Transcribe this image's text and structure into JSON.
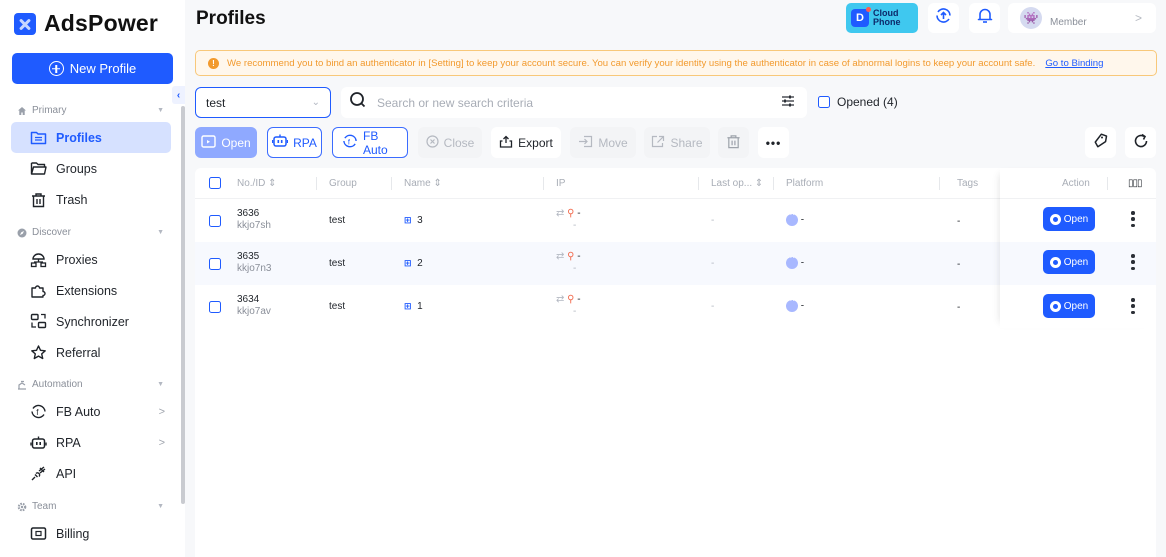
{
  "app": {
    "brand": "AdsPower",
    "page_title": "Profiles"
  },
  "sidebar": {
    "new_profile_label": "New Profile",
    "sections": [
      {
        "label": "Primary",
        "icon": "home-icon"
      },
      {
        "label": "Discover",
        "icon": "compass-icon"
      },
      {
        "label": "Automation",
        "icon": "automation-icon"
      },
      {
        "label": "Team",
        "icon": "gear-icon"
      }
    ],
    "items": [
      {
        "label": "Profiles",
        "icon": "folder-list-icon",
        "active": true
      },
      {
        "label": "Groups",
        "icon": "folder-open-icon"
      },
      {
        "label": "Trash",
        "icon": "trash-icon"
      },
      {
        "label": "Proxies",
        "icon": "proxy-network-icon"
      },
      {
        "label": "Extensions",
        "icon": "puzzle-icon"
      },
      {
        "label": "Synchronizer",
        "icon": "synchronizer-icon"
      },
      {
        "label": "Referral",
        "icon": "star-icon"
      },
      {
        "label": "FB Auto",
        "icon": "fb-auto-icon",
        "has_submenu": true
      },
      {
        "label": "RPA",
        "icon": "robot-icon",
        "has_submenu": true
      },
      {
        "label": "API",
        "icon": "api-plug-icon"
      },
      {
        "label": "Billing",
        "icon": "wallet-icon"
      }
    ]
  },
  "header": {
    "cloud_phone": {
      "line1": "Cloud",
      "line2": "Phone"
    },
    "user": {
      "role": "Member"
    }
  },
  "alert": {
    "message": "We recommend you to bind an authenticator in [Setting] to keep your account secure. You can verify your identity using the authenticator in case of abnormal logins to keep your account safe.",
    "link_label": "Go to Binding"
  },
  "filters": {
    "group_value": "test",
    "search_placeholder": "Search or new search criteria",
    "search_value": "",
    "opened_label": "Opened (4)"
  },
  "toolbar": {
    "open": "Open",
    "rpa": "RPA",
    "fb_auto": "FB Auto",
    "close": "Close",
    "export": "Export",
    "move": "Move",
    "share": "Share"
  },
  "table": {
    "headers": {
      "no_id": "No./ID",
      "group": "Group",
      "name": "Name",
      "ip": "IP",
      "last_op": "Last op...",
      "platform": "Platform",
      "tags": "Tags",
      "action": "Action"
    },
    "rows": [
      {
        "no": "3636",
        "id": "kkjo7sh",
        "group": "test",
        "name": "3",
        "ip": "-",
        "ip_sub": "-",
        "last_op": "-",
        "platform": "-",
        "tags": "-",
        "action": "Open"
      },
      {
        "no": "3635",
        "id": "kkjo7n3",
        "group": "test",
        "name": "2",
        "ip": "-",
        "ip_sub": "-",
        "last_op": "-",
        "platform": "-",
        "tags": "-",
        "action": "Open"
      },
      {
        "no": "3634",
        "id": "kkjo7av",
        "group": "test",
        "name": "1",
        "ip": "-",
        "ip_sub": "-",
        "last_op": "-",
        "platform": "-",
        "tags": "-",
        "action": "Open"
      }
    ]
  }
}
